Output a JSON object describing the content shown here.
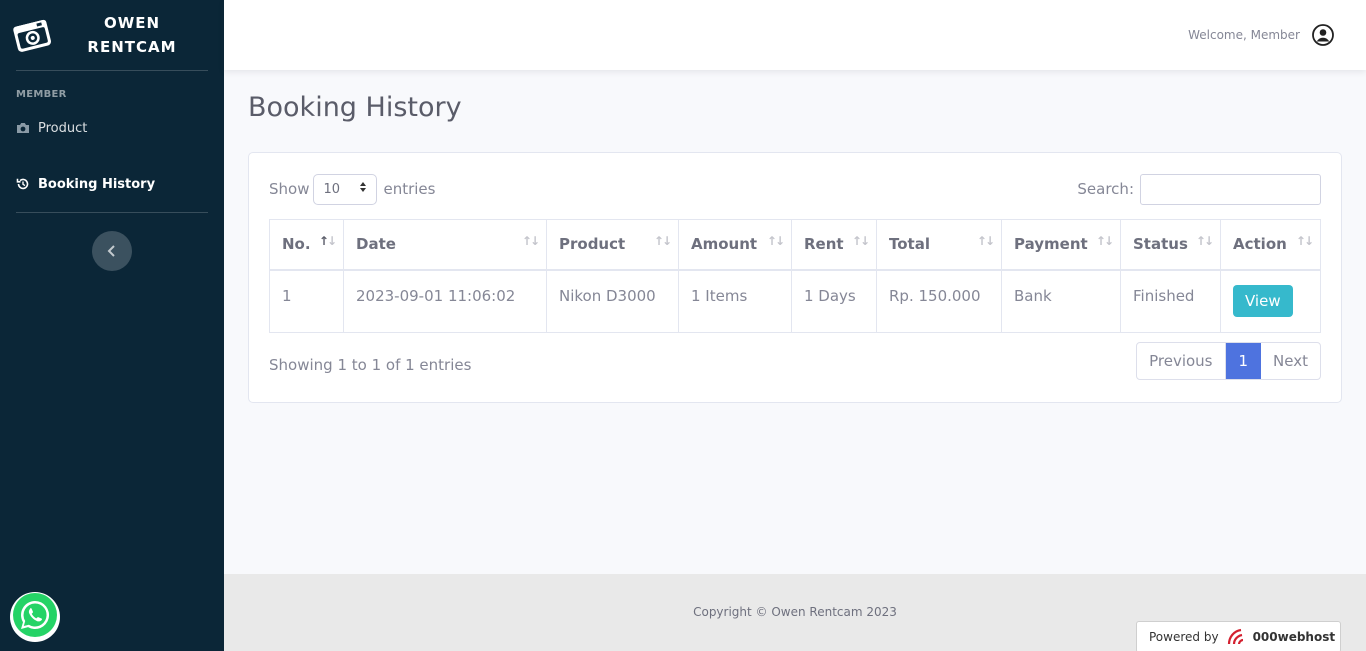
{
  "sidebar": {
    "brand_line1": "OWEN",
    "brand_line2": "RENTCAM",
    "heading": "MEMBER",
    "items": [
      {
        "label": "Product",
        "icon": "camera-icon"
      },
      {
        "label": "Booking History",
        "icon": "history-icon",
        "active": true
      }
    ]
  },
  "topbar": {
    "welcome": "Welcome, Member"
  },
  "page": {
    "title": "Booking History"
  },
  "table_controls": {
    "show": "Show",
    "length": "10",
    "entries": "entries",
    "search_label": "Search:",
    "search_value": ""
  },
  "table": {
    "columns": [
      "No.",
      "Date",
      "Product",
      "Amount",
      "Rent",
      "Total",
      "Payment",
      "Status",
      "Action"
    ],
    "rows": [
      {
        "no": "1",
        "date": "2023-09-01 11:06:02",
        "product": "Nikon D3000",
        "amount": "1 Items",
        "rent": "1 Days",
        "total": "Rp. 150.000",
        "payment": "Bank",
        "status": "Finished",
        "action": "View"
      }
    ]
  },
  "pagination": {
    "info": "Showing 1 to 1 of 1 entries",
    "previous": "Previous",
    "current": "1",
    "next": "Next"
  },
  "footer": {
    "copyright": "Copyright © Owen Rentcam 2023",
    "powered_by": "Powered by",
    "host": "000webhost"
  },
  "colors": {
    "sidebar": "#0b2637",
    "primary": "#4e73df",
    "info": "#36b9cc",
    "whatsapp": "#25d366"
  }
}
